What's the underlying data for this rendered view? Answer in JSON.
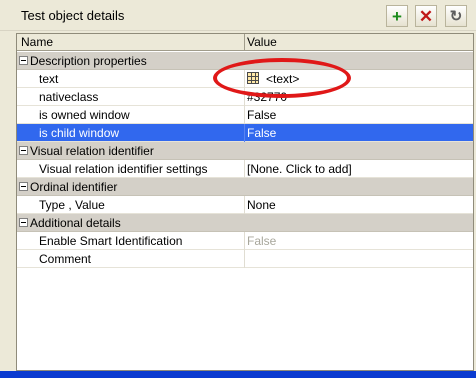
{
  "panel": {
    "title": "Test object details",
    "buttons": [
      {
        "icon": "plus-icon",
        "symbol": "+",
        "color": "#1a8a1a"
      },
      {
        "icon": "close-icon",
        "symbol": "✕",
        "color": "#c01818"
      },
      {
        "icon": "refresh-icon",
        "symbol": "↻",
        "color": "#5d5d5d"
      }
    ]
  },
  "grid": {
    "headers": {
      "name": "Name",
      "value": "Value"
    },
    "rows": [
      {
        "type": "section",
        "name": "Description properties",
        "value": ""
      },
      {
        "type": "property",
        "name": "text",
        "value": "<text>",
        "icon": "table-icon"
      },
      {
        "type": "property",
        "name": "nativeclass",
        "value": "#32770"
      },
      {
        "type": "property",
        "name": "is owned window",
        "value": "False"
      },
      {
        "type": "property",
        "name": "is child window",
        "value": "False",
        "selected": true
      },
      {
        "type": "section",
        "name": "Visual relation identifier",
        "value": ""
      },
      {
        "type": "property",
        "name": "Visual relation identifier settings",
        "value": "[None. Click to add]"
      },
      {
        "type": "section",
        "name": "Ordinal identifier",
        "value": ""
      },
      {
        "type": "property",
        "name": "Type , Value",
        "value": "None"
      },
      {
        "type": "section",
        "name": "Additional details",
        "value": ""
      },
      {
        "type": "property",
        "name": "Enable Smart Identification",
        "value": "False",
        "disabled": true
      },
      {
        "type": "property",
        "name": "Comment",
        "value": ""
      }
    ]
  },
  "colors": {
    "selection": "#3168ee",
    "annotation": "#e01818",
    "section_bg": "#d4d0c8"
  }
}
